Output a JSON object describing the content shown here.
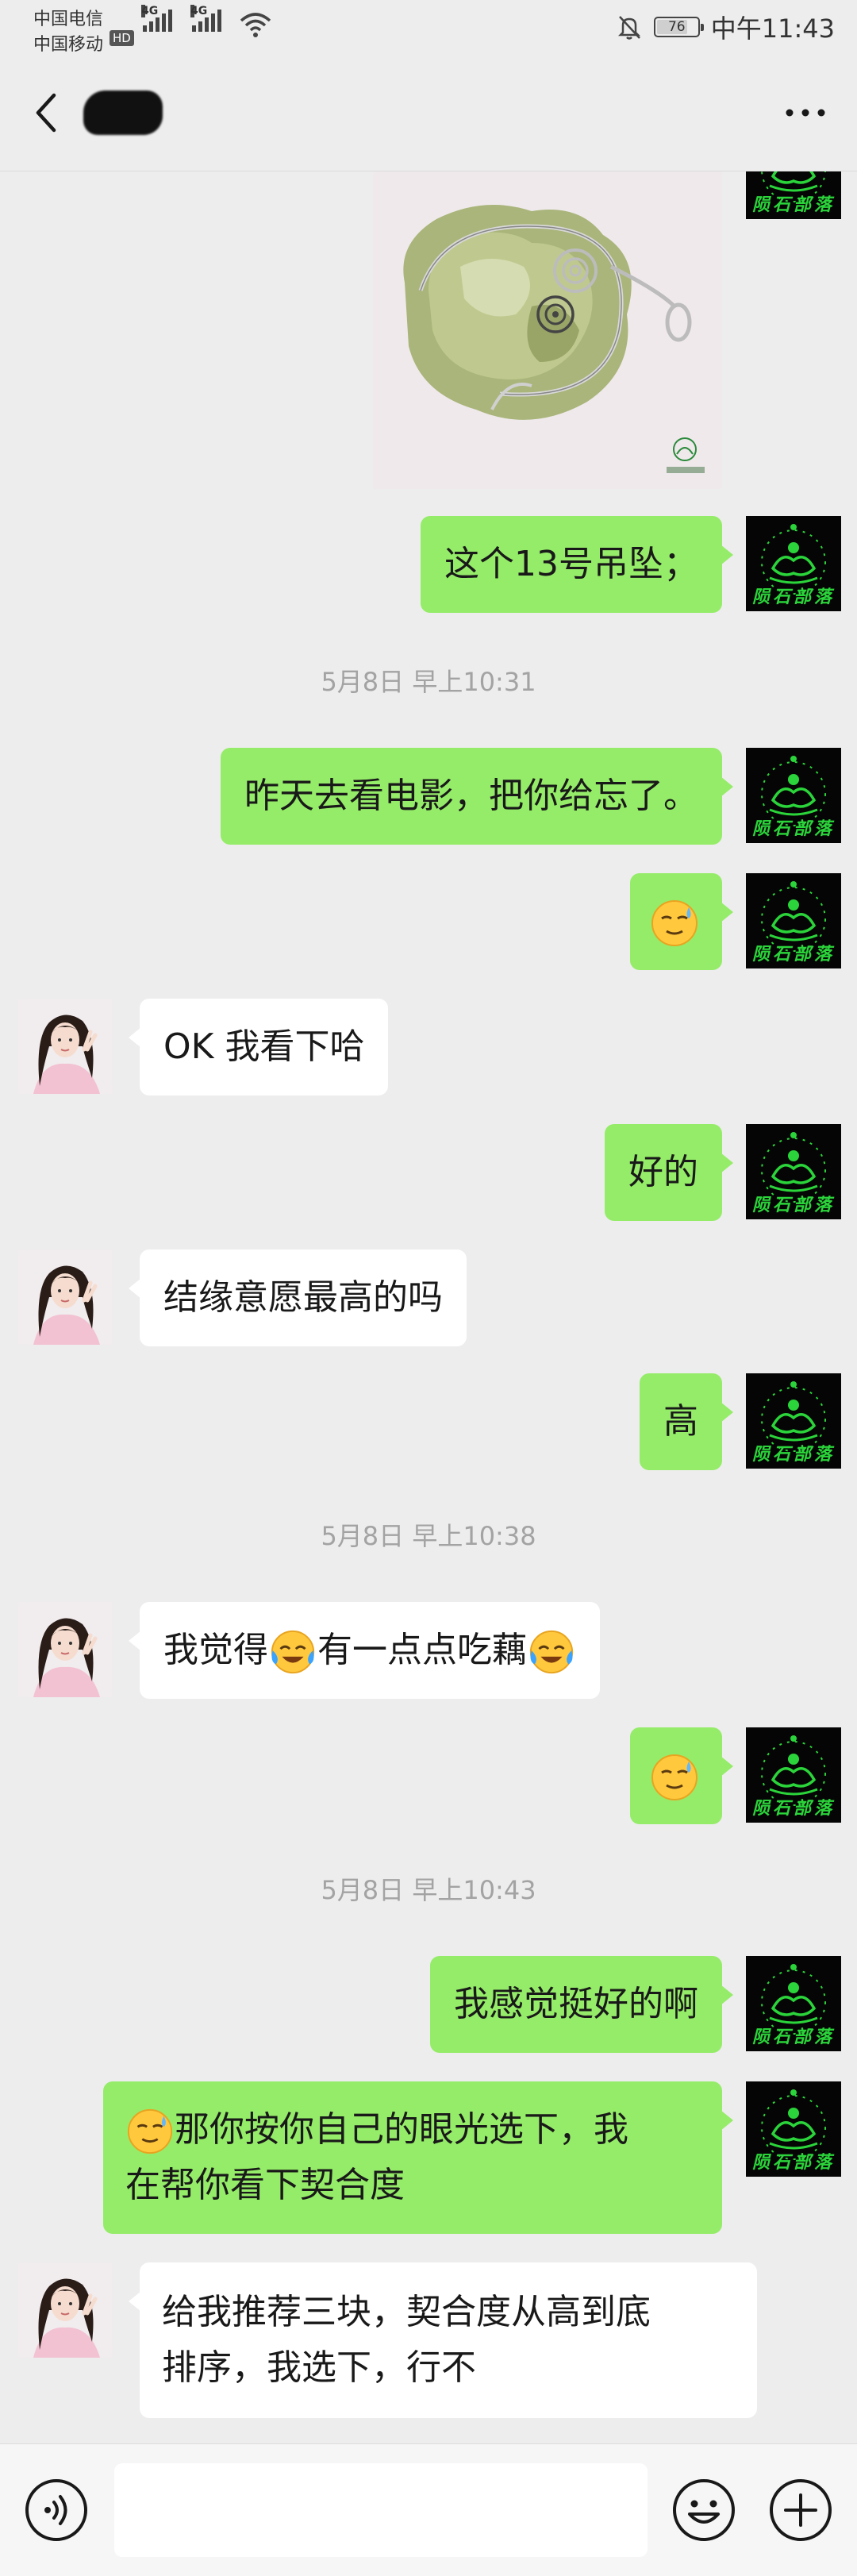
{
  "status_bar": {
    "carrier1": "中国电信",
    "carrier2": "中国移动",
    "hd": "HD",
    "net1": "4G",
    "net2": "4G",
    "battery_level": "76",
    "battery_fraction": 0.76,
    "time": "中午11:43"
  },
  "icons": {
    "back": "chevron-left-icon",
    "more": "more-dots-icon",
    "voice": "voice-icon",
    "emoji": "emoji-icon",
    "plus": "plus-icon",
    "bell": "bell-off-icon",
    "wifi": "wifi-icon"
  },
  "colors": {
    "my_bubble": "#95ec69",
    "her_bubble": "#ffffff",
    "background": "#ededed",
    "timestamp": "#a3a3a3",
    "avatar_green": "#2bd43a"
  },
  "avatar_me": {
    "caption": "陨石部落"
  },
  "messages": {
    "m1": "这个13号吊坠；",
    "t1": "5月8日 早上10:31",
    "m2": "昨天去看电影，把你给忘了。",
    "m4": "OK 我看下哈",
    "m5": "好的",
    "m6": "结缘意愿最高的吗",
    "m7": "高",
    "t2": "5月8日 早上10:38",
    "m8_a": "我觉得",
    "m8_b": "有一点点吃藕",
    "t3": "5月8日 早上10:43",
    "m10": "我感觉挺好的啊",
    "m11_a": "那你按你自己的眼光选下，我",
    "m11_b": "在帮你看下契合度",
    "m12_a": "给我推荐三块，契合度从高到底",
    "m12_b": "排序，我选下，行不"
  },
  "input": {
    "value": ""
  }
}
